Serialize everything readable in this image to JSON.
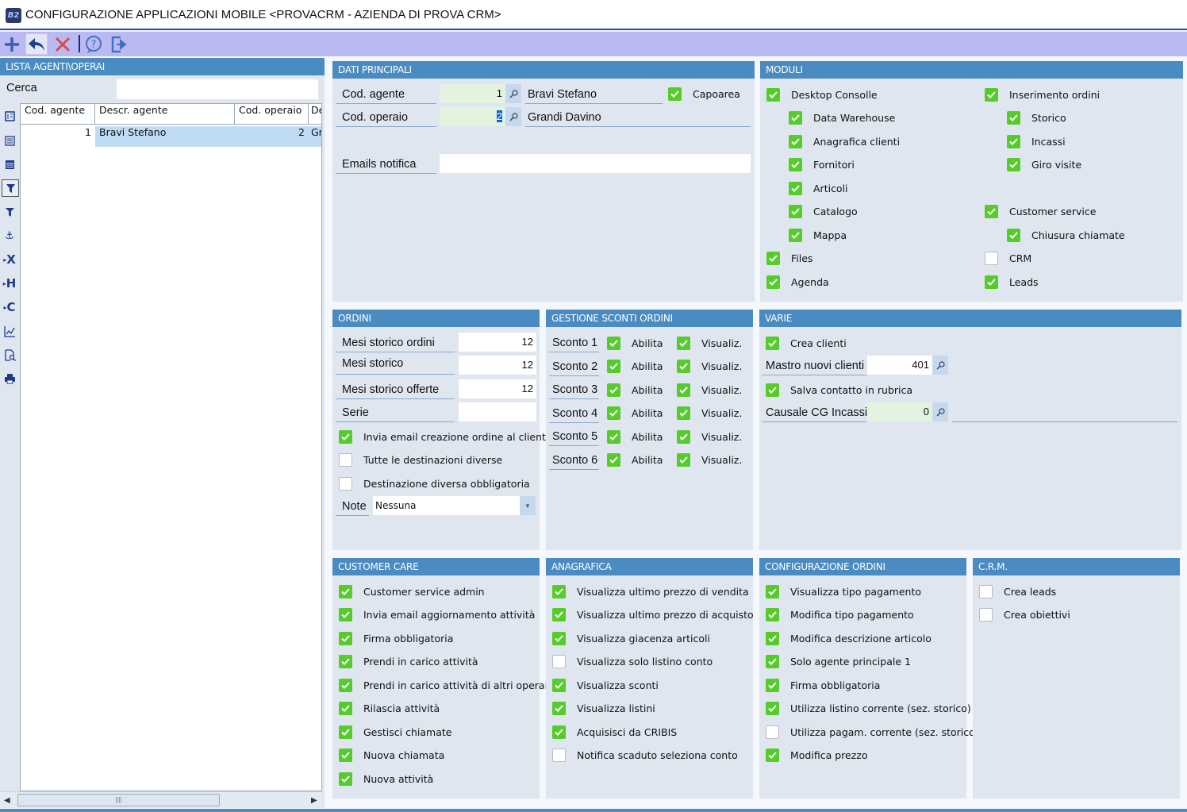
{
  "window": {
    "title": "CONFIGURAZIONE APPLICAZIONI MOBILE <PROVACRM - AZIENDA DI PROVA CRM>",
    "logo": "B2"
  },
  "toolbar": {
    "icons": [
      "plus-icon",
      "undo-icon",
      "delete-icon",
      "help-icon",
      "exit-icon"
    ]
  },
  "colors": {
    "header": "#4a8bc2",
    "panel": "#dfe6f0",
    "toolbar": "#babaf3",
    "check": "#55cc2c"
  },
  "left": {
    "title": "LISTA AGENTI\\OPERAI",
    "search_label": "Cerca",
    "search_value": "",
    "columns": [
      "Cod. agente",
      "Descr. agente",
      "Cod. operaio",
      "De"
    ],
    "rows": [
      [
        "1",
        "Bravi Stefano",
        "2",
        "Gr"
      ]
    ],
    "strip_icons": [
      "form-icon",
      "list-icon",
      "list-icon",
      "filter-active-icon",
      "filter-text-icon",
      "anchor-icon",
      "export-x-icon",
      "export-h-icon",
      "export-c-icon",
      "chart-icon",
      "preview-icon",
      "print-icon"
    ],
    "strip_labels": {
      "x": "X",
      "h": "H",
      "c": "C"
    }
  },
  "dati": {
    "title": "DATI PRINCIPALI",
    "cod_agente_label": "Cod. agente",
    "cod_agente": "1",
    "agente_nome": "Bravi Stefano",
    "capoarea": {
      "label": "Capoarea",
      "checked": true
    },
    "cod_operaio_label": "Cod. operaio",
    "cod_operaio": "2",
    "operaio_nome": "Grandi Davino",
    "emails_label": "Emails notifica",
    "emails": ""
  },
  "moduli": {
    "title": "MODULI",
    "left": [
      {
        "label": "Desktop Consolle",
        "checked": true
      },
      {
        "label": "Data Warehouse",
        "checked": true
      },
      {
        "label": "Anagrafica clienti",
        "checked": true
      },
      {
        "label": "Fornitori",
        "checked": true
      },
      {
        "label": "Articoli",
        "checked": true
      },
      {
        "label": "Catalogo",
        "checked": true
      },
      {
        "label": "Mappa",
        "checked": true
      },
      {
        "label": "Files",
        "checked": true
      },
      {
        "label": "Agenda",
        "checked": true
      }
    ],
    "right": [
      {
        "label": "Inserimento ordini",
        "checked": true
      },
      {
        "label": "Storico",
        "checked": true
      },
      {
        "label": "Incassi",
        "checked": true
      },
      {
        "label": "Giro visite",
        "checked": true
      },
      {
        "label": "Customer service",
        "checked": true
      },
      {
        "label": "Chiusura chiamate",
        "checked": true
      },
      {
        "label": "CRM",
        "checked": false
      },
      {
        "label": "Leads",
        "checked": true
      }
    ]
  },
  "ordini": {
    "title": "ORDINI",
    "fields": [
      {
        "label": "Mesi storico ordini",
        "value": "12"
      },
      {
        "label": "Mesi storico",
        "value": "12"
      },
      {
        "label": "Mesi storico offerte",
        "value": "12"
      },
      {
        "label": "Serie",
        "value": ""
      }
    ],
    "checks": [
      {
        "label": "Invia email creazione ordine al cliente",
        "checked": true
      },
      {
        "label": "Tutte le destinazioni diverse",
        "checked": false
      },
      {
        "label": "Destinazione diversa obbligatoria",
        "checked": false
      }
    ],
    "note_label": "Note",
    "note_value": "Nessuna"
  },
  "sconti": {
    "title": "GESTIONE SCONTI ORDINI",
    "abilita": "Abilita",
    "visualiz": "Visualiz.",
    "rows": [
      {
        "label": "Sconto 1",
        "abilita": true,
        "visualiz": true
      },
      {
        "label": "Sconto 2",
        "abilita": true,
        "visualiz": true
      },
      {
        "label": "Sconto 3",
        "abilita": true,
        "visualiz": true
      },
      {
        "label": "Sconto 4",
        "abilita": true,
        "visualiz": true
      },
      {
        "label": "Sconto 5",
        "abilita": true,
        "visualiz": true
      },
      {
        "label": "Sconto 6",
        "abilita": true,
        "visualiz": true
      }
    ]
  },
  "varie": {
    "title": "VARIE",
    "crea_clienti": {
      "label": "Crea clienti",
      "checked": true
    },
    "mastro_label": "Mastro nuovi clienti",
    "mastro": "401",
    "salva": {
      "label": "Salva contatto in rubrica",
      "checked": true
    },
    "causale_label": "Causale CG Incassi",
    "causale": "0",
    "causale_desc": ""
  },
  "customer_care": {
    "title": "CUSTOMER CARE",
    "items": [
      {
        "label": "Customer service admin",
        "checked": true
      },
      {
        "label": "Invia email aggiornamento attività",
        "checked": true
      },
      {
        "label": "Firma obbligatoria",
        "checked": true
      },
      {
        "label": "Prendi in carico attività",
        "checked": true
      },
      {
        "label": "Prendi in carico attività di altri operai",
        "checked": true
      },
      {
        "label": "Rilascia attività",
        "checked": true
      },
      {
        "label": "Gestisci chiamate",
        "checked": true
      },
      {
        "label": "Nuova chiamata",
        "checked": true
      },
      {
        "label": "Nuova attività",
        "checked": true
      }
    ]
  },
  "anagrafica": {
    "title": "ANAGRAFICA",
    "items": [
      {
        "label": "Visualizza ultimo prezzo di vendita",
        "checked": true
      },
      {
        "label": "Visualizza ultimo prezzo di acquisto",
        "checked": true
      },
      {
        "label": "Visualizza giacenza articoli",
        "checked": true
      },
      {
        "label": "Visualizza solo listino conto",
        "checked": false
      },
      {
        "label": "Visualizza sconti",
        "checked": true
      },
      {
        "label": "Visualizza listini",
        "checked": true
      },
      {
        "label": "Acquisisci da CRIBIS",
        "checked": true
      },
      {
        "label": "Notifica scaduto seleziona conto",
        "checked": false
      }
    ]
  },
  "config_ordini": {
    "title": "CONFIGURAZIONE ORDINI",
    "items": [
      {
        "label": "Visualizza tipo pagamento",
        "checked": true
      },
      {
        "label": "Modifica tipo pagamento",
        "checked": true
      },
      {
        "label": "Modifica descrizione articolo",
        "checked": true
      },
      {
        "label": "Solo agente principale 1",
        "checked": true
      },
      {
        "label": "Firma obbligatoria",
        "checked": true
      },
      {
        "label": "Utilizza listino corrente (sez. storico)",
        "checked": true
      },
      {
        "label": "Utilizza pagam. corrente (sez. storico)",
        "checked": false
      },
      {
        "label": "Modifica prezzo",
        "checked": true
      }
    ]
  },
  "crm": {
    "title": "C.R.M.",
    "items": [
      {
        "label": "Crea leads",
        "checked": false
      },
      {
        "label": "Crea obiettivi",
        "checked": false
      }
    ]
  }
}
